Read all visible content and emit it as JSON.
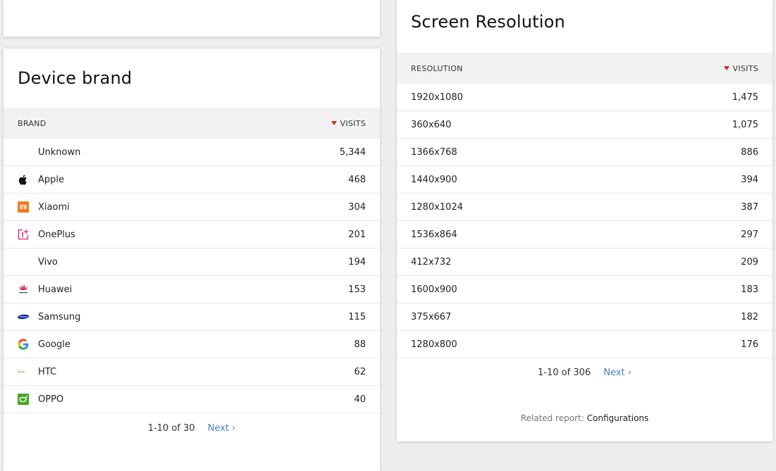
{
  "device_brand": {
    "title": "Device brand",
    "col_label": "BRAND",
    "col_value": "VISITS",
    "rows": [
      {
        "label": "Unknown",
        "value": "5,344",
        "icon": "none"
      },
      {
        "label": "Apple",
        "value": "468",
        "icon": "apple-icon"
      },
      {
        "label": "Xiaomi",
        "value": "304",
        "icon": "xiaomi-icon"
      },
      {
        "label": "OnePlus",
        "value": "201",
        "icon": "oneplus-icon"
      },
      {
        "label": "Vivo",
        "value": "194",
        "icon": "none"
      },
      {
        "label": "Huawei",
        "value": "153",
        "icon": "huawei-icon"
      },
      {
        "label": "Samsung",
        "value": "115",
        "icon": "samsung-icon"
      },
      {
        "label": "Google",
        "value": "88",
        "icon": "google-icon"
      },
      {
        "label": "HTC",
        "value": "62",
        "icon": "htc-icon"
      },
      {
        "label": "OPPO",
        "value": "40",
        "icon": "oppo-icon"
      }
    ],
    "pagination": "1-10 of 30",
    "next_label": "Next ›"
  },
  "screen_resolution": {
    "title": "Screen Resolution",
    "col_label": "RESOLUTION",
    "col_value": "VISITS",
    "rows": [
      {
        "label": "1920x1080",
        "value": "1,475"
      },
      {
        "label": "360x640",
        "value": "1,075"
      },
      {
        "label": "1366x768",
        "value": "886"
      },
      {
        "label": "1440x900",
        "value": "394"
      },
      {
        "label": "1280x1024",
        "value": "387"
      },
      {
        "label": "1536x864",
        "value": "297"
      },
      {
        "label": "412x732",
        "value": "209"
      },
      {
        "label": "1600x900",
        "value": "183"
      },
      {
        "label": "375x667",
        "value": "182"
      },
      {
        "label": "1280x800",
        "value": "176"
      }
    ],
    "pagination": "1-10 of 306",
    "next_label": "Next ›",
    "related_prefix": "Related report:",
    "related_link": "Configurations"
  },
  "colors": {
    "sort_arrow": "#d4291f",
    "link": "#4a84b5",
    "header_bg": "#f2f2f2",
    "page_bg": "#eeeeee"
  }
}
